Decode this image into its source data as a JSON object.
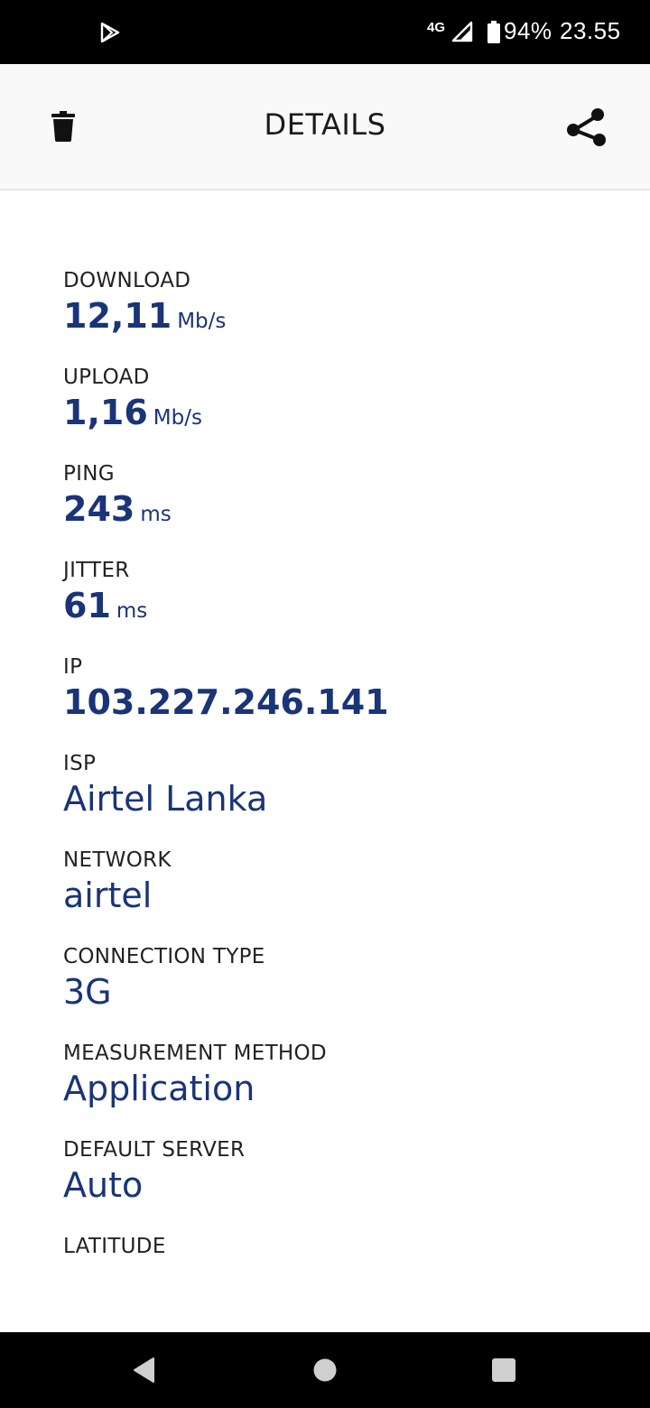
{
  "status_bar": {
    "network_type": "4G",
    "battery": "94%",
    "time": "23.55"
  },
  "app_bar": {
    "title": "DETAILS",
    "delete_icon": "trash-icon",
    "share_icon": "share-icon"
  },
  "details": [
    {
      "label": "DOWNLOAD",
      "value": "12,11",
      "unit": "Mb/s"
    },
    {
      "label": "UPLOAD",
      "value": "1,16",
      "unit": "Mb/s"
    },
    {
      "label": "PING",
      "value": "243",
      "unit": "ms"
    },
    {
      "label": "JITTER",
      "value": "61",
      "unit": "ms"
    },
    {
      "label": "IP",
      "value": "103.227.246.141",
      "unit": ""
    },
    {
      "label": "ISP",
      "value": "Airtel Lanka",
      "unit": ""
    },
    {
      "label": "NETWORK",
      "value": "airtel",
      "unit": ""
    },
    {
      "label": "CONNECTION TYPE",
      "value": "3G",
      "unit": ""
    },
    {
      "label": "MEASUREMENT METHOD",
      "value": "Application",
      "unit": ""
    },
    {
      "label": "DEFAULT SERVER",
      "value": "Auto",
      "unit": ""
    },
    {
      "label": "LATITUDE",
      "value": "",
      "unit": ""
    }
  ],
  "colors": {
    "value_text": "#1a3478",
    "label_text": "#222222",
    "app_bar_bg": "#f9f9f9",
    "system_bar_bg": "#000000"
  }
}
